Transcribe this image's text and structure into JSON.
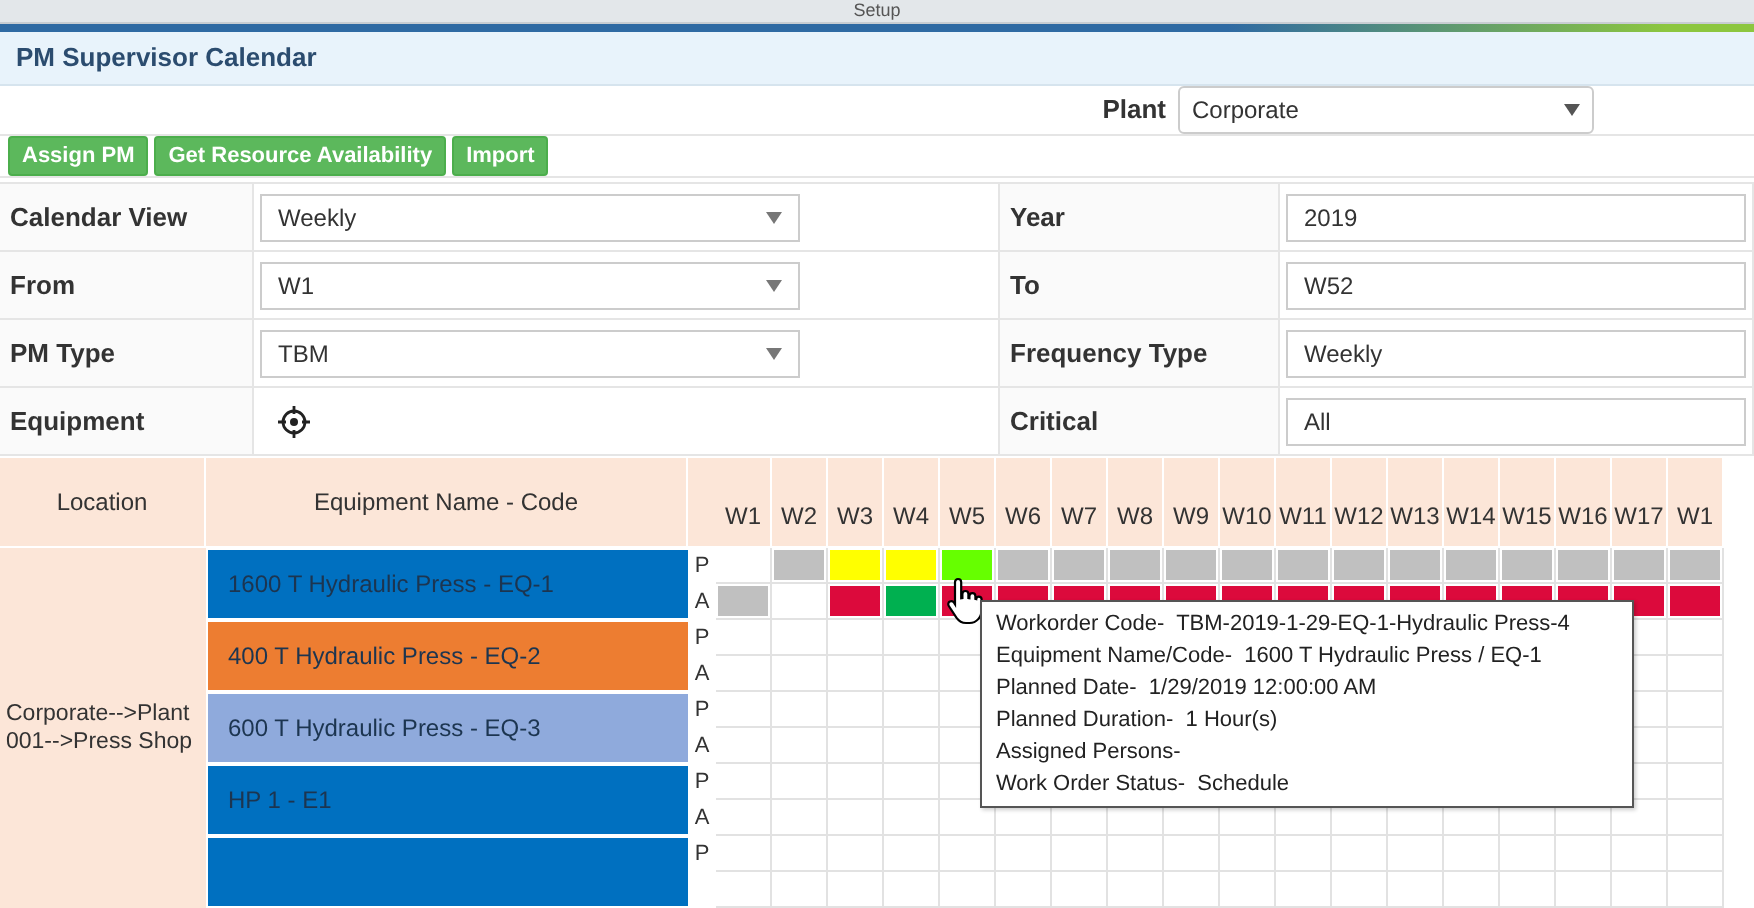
{
  "top_tab": {
    "label": "Setup"
  },
  "page_title": "PM Supervisor Calendar",
  "plant": {
    "label": "Plant",
    "value": "Corporate"
  },
  "buttons": [
    "Assign PM",
    "Get Resource Availability",
    "Import"
  ],
  "filters": [
    {
      "label": "Calendar View",
      "kind": "select",
      "value": "Weekly"
    },
    {
      "label": "Year",
      "kind": "field",
      "value": "2019"
    },
    {
      "label": "From",
      "kind": "select",
      "value": "W1"
    },
    {
      "label": "To",
      "kind": "field",
      "value": "W52"
    },
    {
      "label": "PM Type",
      "kind": "select",
      "value": "TBM"
    },
    {
      "label": "Frequency Type",
      "kind": "field",
      "value": "Weekly"
    },
    {
      "label": "Equipment",
      "kind": "picker"
    },
    {
      "label": "Critical",
      "kind": "field",
      "value": "All"
    }
  ],
  "calendar": {
    "location_header": "Location",
    "equipment_header": "Equipment Name - Code",
    "weeks": [
      "W1",
      "W2",
      "W3",
      "W4",
      "W5",
      "W6",
      "W7",
      "W8",
      "W9",
      "W10",
      "W11",
      "W12",
      "W13",
      "W14",
      "W15",
      "W16",
      "W17",
      "W1"
    ],
    "location": "Corporate-->Plant 001-->Press Shop",
    "rows": [
      {
        "name": "1600 T Hydraulic Press - EQ-1",
        "color": "#0070c0",
        "p_label": "P",
        "a_label": "A",
        "plan": [
          {
            "color": "#ffffff"
          },
          {
            "color": "#c0c0c0"
          },
          {
            "color": "#ffff00"
          },
          {
            "color": "#ffff00"
          },
          {
            "color": "#66ff00"
          },
          {
            "color": "#c0c0c0"
          },
          {
            "color": "#c0c0c0"
          },
          {
            "color": "#c0c0c0"
          },
          {
            "color": "#c0c0c0"
          },
          {
            "color": "#c0c0c0"
          },
          {
            "color": "#c0c0c0"
          },
          {
            "color": "#c0c0c0"
          },
          {
            "color": "#c0c0c0"
          },
          {
            "color": "#c0c0c0"
          },
          {
            "color": "#c0c0c0"
          },
          {
            "color": "#c0c0c0"
          },
          {
            "color": "#c0c0c0"
          },
          {
            "color": "#c0c0c0"
          }
        ],
        "actual": [
          {
            "color": "#c0c0c0"
          },
          {
            "color": "#ffffff"
          },
          {
            "color": "#dc0a3c"
          },
          {
            "color": "#00b050"
          },
          {
            "color": "#dc0a3c"
          },
          {
            "color": "#dc0a3c"
          },
          {
            "color": "#dc0a3c"
          },
          {
            "color": "#dc0a3c"
          },
          {
            "color": "#dc0a3c"
          },
          {
            "color": "#dc0a3c"
          },
          {
            "color": "#dc0a3c"
          },
          {
            "color": "#dc0a3c"
          },
          {
            "color": "#dc0a3c"
          },
          {
            "color": "#dc0a3c"
          },
          {
            "color": "#dc0a3c"
          },
          {
            "color": "#dc0a3c"
          },
          {
            "color": "#dc0a3c"
          },
          {
            "color": "#dc0a3c"
          }
        ]
      },
      {
        "name": "400 T Hydraulic Press - EQ-2",
        "color": "#ed7d31",
        "p_label": "P",
        "a_label": "A"
      },
      {
        "name": "600 T Hydraulic Press - EQ-3",
        "color": "#8faadc",
        "p_label": "P",
        "a_label": "A"
      },
      {
        "name": "HP 1 - E1",
        "color": "#0070c0",
        "p_label": "P",
        "a_label": "A"
      },
      {
        "color": "#0070c0",
        "p_label": "P"
      }
    ]
  },
  "tooltip": [
    {
      "label": "Workorder Code-",
      "value": "TBM-2019-1-29-EQ-1-Hydraulic Press-4"
    },
    {
      "label": "Equipment Name/Code-",
      "value": "1600 T Hydraulic Press / EQ-1"
    },
    {
      "label": "Planned Date-",
      "value": "1/29/2019 12:00:00 AM"
    },
    {
      "label": "Planned Duration-",
      "value": "1 Hour(s)"
    },
    {
      "label": "Assigned Persons-"
    },
    {
      "label": "Work Order Status-",
      "value": "Schedule"
    }
  ]
}
